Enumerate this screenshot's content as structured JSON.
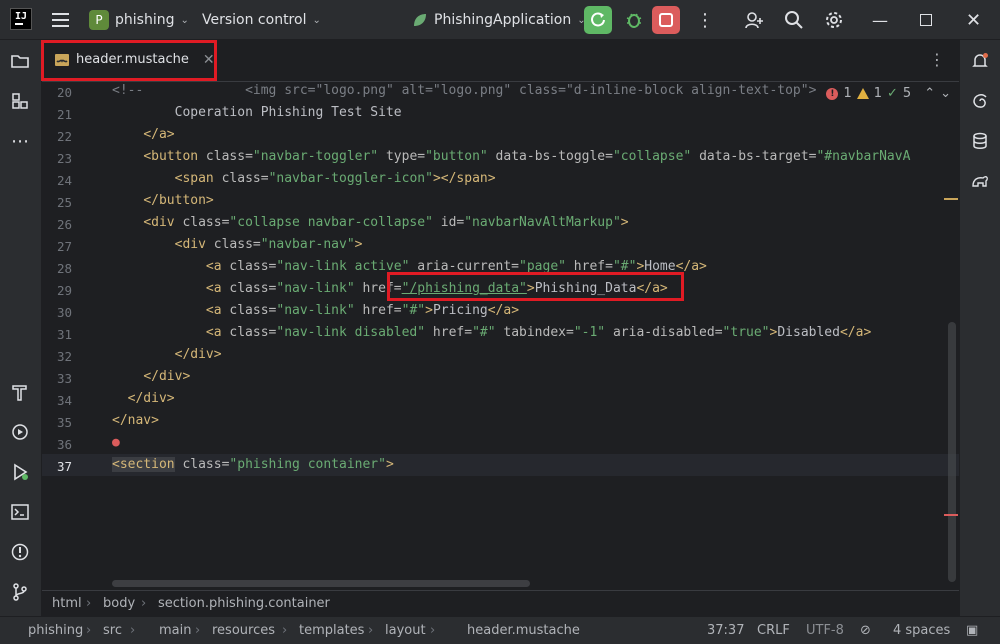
{
  "titlebar": {
    "project_badge": "P",
    "project_name": "phishing",
    "version_control": "Version control",
    "run_config": "PhishingApplication"
  },
  "tab": {
    "filename": "header.mustache"
  },
  "inspections": {
    "errors": "1",
    "warnings": "1",
    "ok": "5"
  },
  "code_lines": [
    {
      "n": "20"
    },
    {
      "n": "21"
    },
    {
      "n": "22"
    },
    {
      "n": "23"
    },
    {
      "n": "24"
    },
    {
      "n": "25"
    },
    {
      "n": "26"
    },
    {
      "n": "27"
    },
    {
      "n": "28"
    },
    {
      "n": "29"
    },
    {
      "n": "30"
    },
    {
      "n": "31"
    },
    {
      "n": "32"
    },
    {
      "n": "33"
    },
    {
      "n": "34"
    },
    {
      "n": "35"
    },
    {
      "n": "36"
    },
    {
      "n": "37"
    }
  ],
  "code": {
    "l20_a": "<!--",
    "l20_b": "<img src=\"logo.png\" alt=\"logo.png\" class=\"d-inline-block align-text-top\">",
    "l21": "Coperation Phishing Test Site",
    "l22": "</a>",
    "l23_tag": "<button",
    "l23_a1": " class=",
    "l23_s1": "\"navbar-toggler\"",
    "l23_a2": " type=",
    "l23_s2": "\"button\"",
    "l23_a3": " data-bs-toggle=",
    "l23_s3": "\"collapse\"",
    "l23_a4": " data-bs-target=",
    "l23_s4": "\"#navbarNavA",
    "l24_tag": "<span",
    "l24_a1": " class=",
    "l24_s1": "\"navbar-toggler-icon\"",
    "l24_end": "></span>",
    "l25": "</button>",
    "l26_tag": "<div",
    "l26_a1": " class=",
    "l26_s1": "\"collapse navbar-collapse\"",
    "l26_a2": " id=",
    "l26_s2": "\"navbarNavAltMarkup\"",
    "l26_end": ">",
    "l27_tag": "<div",
    "l27_a1": " class=",
    "l27_s1": "\"navbar-nav\"",
    "l27_end": ">",
    "l28_tag": "<a",
    "l28_a1": " class=",
    "l28_s1": "\"nav-link active\"",
    "l28_a2": " aria-current=",
    "l28_s2": "\"page\"",
    "l28_a3": " href=",
    "l28_s3": "\"#\"",
    "l28_gt": ">",
    "l28_txt": "Home",
    "l28_end": "</a>",
    "l29_tag": "<a",
    "l29_a1": " class=",
    "l29_s1": "\"nav-link\"",
    "l29_a2": " href=",
    "l29_s2": "\"/phishing_data\"",
    "l29_gt": ">",
    "l29_txt": "Phishing_Data",
    "l29_end": "</a>",
    "l30_tag": "<a",
    "l30_a1": " class=",
    "l30_s1": "\"nav-link\"",
    "l30_a2": " href=",
    "l30_s2": "\"#\"",
    "l30_gt": ">",
    "l30_txt": "Pricing",
    "l30_end": "</a>",
    "l31_tag": "<a",
    "l31_a1": " class=",
    "l31_s1": "\"nav-link disabled\"",
    "l31_a2": " href=",
    "l31_s2": "\"#\"",
    "l31_a3": " tabindex=",
    "l31_s3": "\"-1\"",
    "l31_a4": " aria-disabled=",
    "l31_s4": "\"true\"",
    "l31_gt": ">",
    "l31_txt": "Disabled",
    "l31_end": "</a>",
    "l32": "</div>",
    "l33": "</div>",
    "l34": "</div>",
    "l35": "</nav>",
    "l37_tag": "<section",
    "l37_a1": " class=",
    "l37_s1": "\"phishing container\"",
    "l37_end": ">"
  },
  "breadcrumb": [
    "html",
    "body",
    "section.phishing.container"
  ],
  "statusbar": {
    "path": [
      "phishing",
      "src",
      "main",
      "resources",
      "templates",
      "layout",
      "header.mustache"
    ],
    "position": "37:37",
    "line_sep": "CRLF",
    "encoding": "UTF-8",
    "indent": "4 spaces"
  },
  "colors": {
    "accent": "#3574f0",
    "highlight": "#e01b24",
    "run": "#5fb865",
    "stop": "#db5c5c"
  }
}
